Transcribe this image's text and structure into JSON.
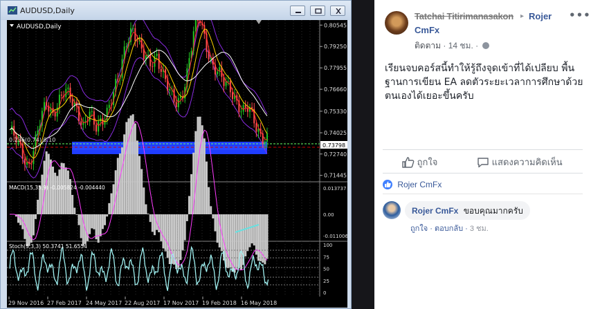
{
  "window": {
    "title": "AUDUSD,Daily",
    "chart_label": "AUDUSD,Daily"
  },
  "chart_data": {
    "type": "line",
    "symbol": "AUDUSD,Daily",
    "price_ticks": [
      "0.80545",
      "0.79250",
      "0.77955",
      "0.76660",
      "0.75330",
      "0.74025",
      "0.72740",
      "0.71445"
    ],
    "current_price": "0.73798",
    "price_range": [
      0.7114,
      0.8085
    ],
    "x_ticks": [
      "29 Nov 2016",
      "27 Feb 2017",
      "24 May 2017",
      "22 Aug 2017",
      "17 Nov 2017",
      "19 Feb 2018",
      "16 May 2018"
    ],
    "fib_label": "0.236(0.74) 0.10",
    "macd_label": "MACD(15,35,9) -0.005824 -0.004440",
    "macd_ticks": [
      "0.013737",
      "0.00",
      "-0.011006"
    ],
    "stoch_label": "Stoch(5,3,3) 50.3741 51.6554",
    "stoch_ticks": [
      "100",
      "75",
      "50",
      "25",
      "0"
    ],
    "series": [
      {
        "name": "close",
        "values": [
          0.742,
          0.736,
          0.728,
          0.72,
          0.732,
          0.747,
          0.758,
          0.752,
          0.76,
          0.765,
          0.76,
          0.755,
          0.745,
          0.752,
          0.742,
          0.748,
          0.755,
          0.765,
          0.775,
          0.795,
          0.805,
          0.795,
          0.785,
          0.782,
          0.788,
          0.776,
          0.765,
          0.758,
          0.762,
          0.778,
          0.8,
          0.81,
          0.795,
          0.782,
          0.776,
          0.77,
          0.768,
          0.76,
          0.752,
          0.755,
          0.747,
          0.739,
          0.736
        ]
      }
    ]
  },
  "post": {
    "author": "Tatchai Titirimanasakon",
    "page_line1": "Rojer",
    "page_line2": "CmFx",
    "follow": "ติดตาม",
    "time": "14 ชม.",
    "dot": "·",
    "text": "เรียนจบคอร์สนี้ทำให้รู้ถึงจุดเข้าที่ได้เปลียบ พื้นฐานการเขียน EA ลดตัวระยะเวลาการศึกษาด้วยตนเองได้เยอะขึ้นครับ",
    "like_label": "ถูกใจ",
    "comment_label": "แสดงความคิดเห็น",
    "liked_by": "Rojer CmFx"
  },
  "comment": {
    "author": "Rojer CmFx",
    "text": "ขอบคุณมากครับ",
    "like": "ถูกใจ",
    "reply": "ตอบกลับ",
    "time": "3 ชม."
  }
}
